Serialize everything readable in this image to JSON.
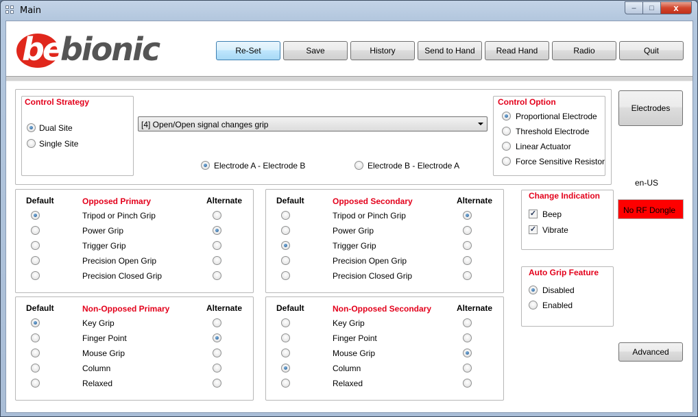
{
  "window": {
    "title": "Main",
    "controls": {
      "minimize": "‒",
      "maximize": "□",
      "close": "x"
    }
  },
  "logo": {
    "part1": "be",
    "part2": "bionic"
  },
  "toolbar": [
    "Re-Set",
    "Save",
    "History",
    "Send to Hand",
    "Read Hand",
    "Radio",
    "Quit"
  ],
  "control_strategy": {
    "title": "Control Strategy",
    "options": [
      {
        "label": "Dual Site",
        "selected": true
      },
      {
        "label": "Single Site",
        "selected": false
      }
    ]
  },
  "mode_select": {
    "value": "[4] Open/Open signal changes grip"
  },
  "electrode_order": [
    {
      "label": "Electrode A  -  Electrode B",
      "selected": true
    },
    {
      "label": "Electrode B  -  Electrode A",
      "selected": false
    }
  ],
  "control_option": {
    "title": "Control Option",
    "options": [
      {
        "label": "Proportional Electrode",
        "selected": true
      },
      {
        "label": "Threshold Electrode",
        "selected": false
      },
      {
        "label": "Linear Actuator",
        "selected": false
      },
      {
        "label": "Force Sensitive Resistor",
        "selected": false
      }
    ]
  },
  "electrodes_button": "Electrodes",
  "locale": "en-US",
  "rf_status": "No RF Dongle",
  "grip_headers": {
    "default": "Default",
    "alternate": "Alternate"
  },
  "grip_groups": [
    {
      "title": "Opposed Primary",
      "rows": [
        {
          "label": "Tripod or Pinch Grip",
          "default": true,
          "alternate": false
        },
        {
          "label": "Power Grip",
          "default": false,
          "alternate": true
        },
        {
          "label": "Trigger Grip",
          "default": false,
          "alternate": false
        },
        {
          "label": "Precision Open Grip",
          "default": false,
          "alternate": false
        },
        {
          "label": "Precision Closed Grip",
          "default": false,
          "alternate": false
        }
      ]
    },
    {
      "title": "Opposed Secondary",
      "rows": [
        {
          "label": "Tripod or Pinch Grip",
          "default": false,
          "alternate": true
        },
        {
          "label": "Power Grip",
          "default": false,
          "alternate": false
        },
        {
          "label": "Trigger Grip",
          "default": true,
          "alternate": false
        },
        {
          "label": "Precision Open Grip",
          "default": false,
          "alternate": false
        },
        {
          "label": "Precision Closed Grip",
          "default": false,
          "alternate": false
        }
      ]
    },
    {
      "title": "Non-Opposed Primary",
      "rows": [
        {
          "label": "Key Grip",
          "default": true,
          "alternate": false
        },
        {
          "label": "Finger Point",
          "default": false,
          "alternate": true
        },
        {
          "label": "Mouse Grip",
          "default": false,
          "alternate": false
        },
        {
          "label": "Column",
          "default": false,
          "alternate": false
        },
        {
          "label": "Relaxed",
          "default": false,
          "alternate": false
        }
      ]
    },
    {
      "title": "Non-Opposed Secondary",
      "rows": [
        {
          "label": "Key Grip",
          "default": false,
          "alternate": false
        },
        {
          "label": "Finger Point",
          "default": false,
          "alternate": false
        },
        {
          "label": "Mouse Grip",
          "default": false,
          "alternate": true
        },
        {
          "label": "Column",
          "default": true,
          "alternate": false
        },
        {
          "label": "Relaxed",
          "default": false,
          "alternate": false
        }
      ]
    }
  ],
  "change_indication": {
    "title": "Change Indication",
    "options": [
      {
        "label": "Beep",
        "checked": true
      },
      {
        "label": "Vibrate",
        "checked": true
      }
    ]
  },
  "auto_grip": {
    "title": "Auto Grip Feature",
    "options": [
      {
        "label": "Disabled",
        "selected": true
      },
      {
        "label": "Enabled",
        "selected": false
      }
    ]
  },
  "advanced_button": "Advanced"
}
